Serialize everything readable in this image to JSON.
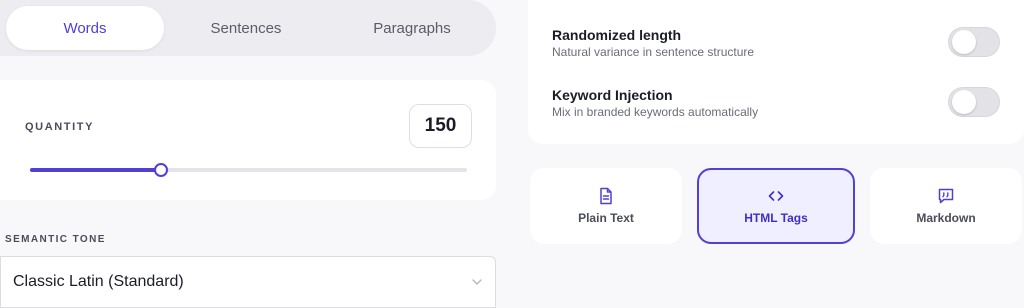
{
  "tabs": [
    {
      "label": "Words",
      "active": true
    },
    {
      "label": "Sentences",
      "active": false
    },
    {
      "label": "Paragraphs",
      "active": false
    }
  ],
  "quantity": {
    "label": "QUANTITY",
    "value": "150",
    "slider_fraction": 0.3
  },
  "tone": {
    "label": "SEMANTIC TONE",
    "selected": "Classic Latin (Standard)"
  },
  "options": [
    {
      "title": "Randomized length",
      "description": "Natural variance in sentence structure",
      "enabled": false
    },
    {
      "title": "Keyword Injection",
      "description": "Mix in branded keywords automatically",
      "enabled": false
    }
  ],
  "formats": [
    {
      "label": "Plain Text",
      "icon": "document-icon",
      "active": false
    },
    {
      "label": "HTML Tags",
      "icon": "code-icon",
      "active": true
    },
    {
      "label": "Markdown",
      "icon": "quote-icon",
      "active": false
    }
  ],
  "colors": {
    "accent": "#5140d4",
    "background": "#f8f8fa"
  }
}
